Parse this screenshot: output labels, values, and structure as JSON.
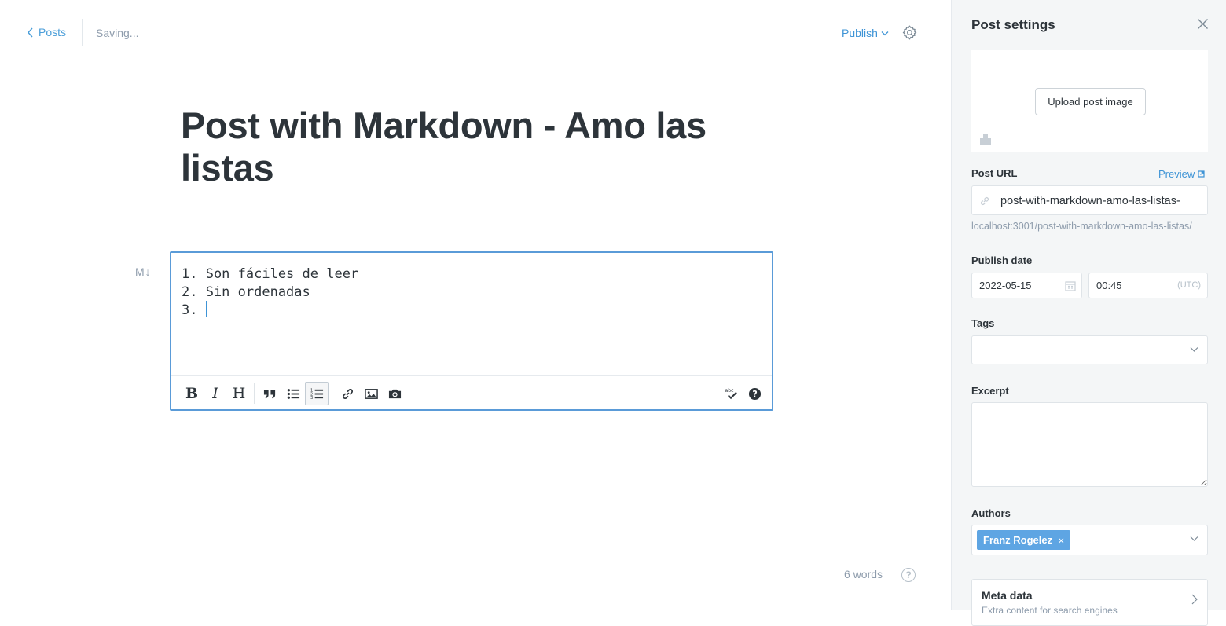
{
  "topbar": {
    "back_label": "Posts",
    "status": "Saving...",
    "publish_label": "Publish"
  },
  "post": {
    "title": "Post with Markdown - Amo las listas",
    "markdown_lines": [
      "1. Son fáciles de leer",
      "2. Sin ordenadas",
      "3. "
    ]
  },
  "editor": {
    "md_badge": "M↓",
    "toolbar_items": [
      "bold",
      "italic",
      "heading",
      "quote",
      "unordered-list",
      "ordered-list",
      "link",
      "image",
      "camera",
      "spellcheck",
      "help"
    ],
    "active_item": "ordered-list",
    "word_count": "6 words",
    "help_glyph": "?"
  },
  "settings": {
    "title": "Post settings",
    "upload_label": "Upload post image",
    "post_url_label": "Post URL",
    "preview_label": "Preview",
    "slug": "post-with-markdown-amo-las-listas-",
    "full_url": "localhost:3001/post-with-markdown-amo-las-listas/",
    "publish_date_label": "Publish date",
    "date": "2022-05-15",
    "time": "00:45",
    "timezone": "(UTC)",
    "tags_label": "Tags",
    "excerpt_label": "Excerpt",
    "excerpt_value": "",
    "authors_label": "Authors",
    "author_token": "Franz Rogelez",
    "token_remove": "×",
    "meta_title": "Meta data",
    "meta_subtitle": "Extra content for search engines"
  },
  "colors": {
    "accent": "#3e94d6",
    "editor_border": "#5a9bd8",
    "token_bg": "#5ea5e3",
    "panel_bg": "#f4f6f7"
  }
}
